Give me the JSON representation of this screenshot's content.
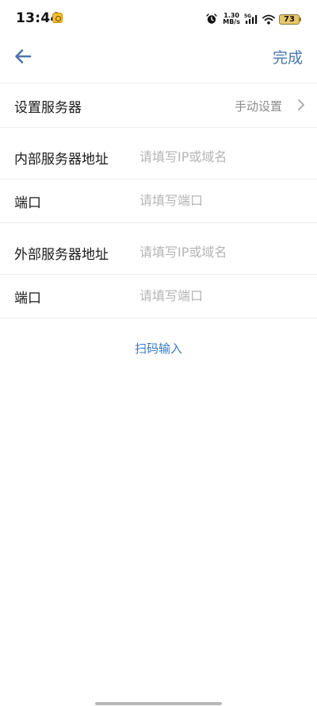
{
  "status_bar": {
    "time": "13:44",
    "net_speed_value": "1.30",
    "net_speed_unit": "MB/s",
    "network_type": "5G",
    "battery_level": "73"
  },
  "nav": {
    "done_label": "完成"
  },
  "server_setting": {
    "label": "设置服务器",
    "value": "手动设置"
  },
  "internal": {
    "address_label": "内部服务器地址",
    "address_placeholder": "请填写IP或域名",
    "port_label": "端口",
    "port_placeholder": "请填写端口"
  },
  "external": {
    "address_label": "外部服务器地址",
    "address_placeholder": "请填写IP或域名",
    "port_label": "端口",
    "port_placeholder": "请填写端口"
  },
  "scan": {
    "label": "扫码输入"
  },
  "colors": {
    "accent": "#4a76ad",
    "link": "#3a78c2",
    "placeholder": "#b5b5b5",
    "divider": "#eeeeee"
  }
}
